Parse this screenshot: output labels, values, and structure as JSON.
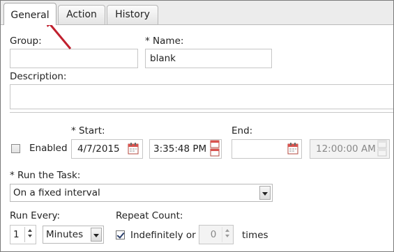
{
  "tabs": [
    {
      "label": "General",
      "active": true
    },
    {
      "label": "Action",
      "active": false
    },
    {
      "label": "History",
      "active": false
    }
  ],
  "group": {
    "label": "Group:",
    "value": ""
  },
  "name": {
    "label": "* Name:",
    "value": "blank"
  },
  "description": {
    "label": "Description:",
    "value": ""
  },
  "enabled": {
    "label": "Enabled",
    "checked": false
  },
  "start": {
    "label": "* Start:",
    "date": "4/7/2015",
    "time": "3:35:48 PM"
  },
  "end": {
    "label": "End:",
    "date": "",
    "time": "12:00:00 AM"
  },
  "run_task": {
    "label": "* Run the Task:",
    "value": "On a fixed interval"
  },
  "run_every": {
    "label": "Run Every:",
    "value": "1",
    "unit": "Minutes"
  },
  "repeat": {
    "label": "Repeat Count:",
    "indefinitely_label": "Indefinitely or",
    "indefinitely_checked": true,
    "count": "0",
    "times_label": "times"
  },
  "colors": {
    "accent_arrow": "#c0202e",
    "calendar_red": "#d9534f"
  }
}
